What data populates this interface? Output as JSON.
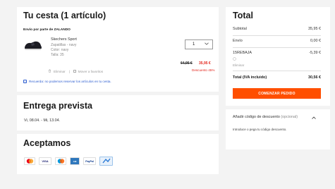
{
  "cart": {
    "title": "Tu cesta (1 artículo)",
    "seller": "Envío por parte de ZALANDO",
    "product": {
      "name": "Skechers Sport",
      "type": "Zapatillas - navy",
      "color": "Color: navy",
      "size": "Talla: 35",
      "quantity": "1",
      "price_old": "64,95 €",
      "price_new": "35,95 €",
      "discount": "Descuento 45%",
      "remove_label": "Eliminar",
      "favorite_label": "Mover a favoritos"
    },
    "notice": "Recuerda: no podemos reservar los artículos en tu cesta."
  },
  "delivery": {
    "title": "Entrega prevista",
    "dates": "Vi, 08.04. - Mi, 13.04."
  },
  "payment": {
    "title": "Aceptamos",
    "methods": [
      "Mastercard",
      "VISA",
      "Maestro",
      "American Express",
      "PayPal",
      "Klarna"
    ]
  },
  "total": {
    "title": "Total",
    "subtotal_label": "Subtotal",
    "subtotal_value": "35,95 €",
    "shipping_label": "Envío",
    "shipping_value": "0,00 €",
    "promo_label": "15REBAJA",
    "promo_value": "-5,39 €",
    "promo_remove": "Eliminar",
    "total_label": "Total (IVA incluido)",
    "total_value": "30,56 €",
    "checkout_label": "COMENZAR PEDIDO"
  },
  "discount": {
    "title": "Añadir código de descuento",
    "optional": "(opcional)",
    "subtitle": "Introduce o pega tu código descuento."
  },
  "colors": {
    "accent": "#ff4f00",
    "sale": "#e3241b",
    "link": "#2f5fd0",
    "background": "#f3f3f3"
  }
}
